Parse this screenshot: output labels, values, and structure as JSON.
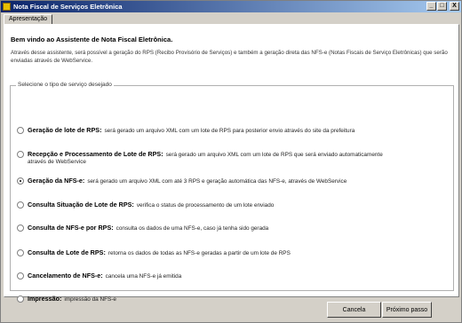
{
  "window": {
    "title": "Nota Fiscal de Serviços Eletrônica",
    "minimize_glyph": "_",
    "maximize_glyph": "□",
    "close_glyph": "X"
  },
  "tabs": [
    {
      "label": "Apresentação"
    }
  ],
  "panel": {
    "welcome": "Bem vindo ao Assistente de Nota Fiscal Eletrônica.",
    "intro": "Através desse assistente, será possível a geração do RPS (Recibo Provisório de Serviços) e também a geração direta das NFS-e (Notas Fiscais de Serviço Eletrônicas) que serão enviadas através de WebService.",
    "group_title": "Selecione o tipo de serviço desejado",
    "options": [
      {
        "label": "Geração de lote de RPS:",
        "desc": "será gerado um arquivo XML com um lote de RPS para posterior envio através do site da prefeitura",
        "checked": false
      },
      {
        "label": "Recepção e Processamento de Lote de RPS:",
        "desc": "será gerado um arquivo XML com um lote de RPS que será enviado automaticamente através de WebService",
        "checked": false
      },
      {
        "label": "Geração da NFS-e:",
        "desc": "será gerado um arquivo XML com até 3 RPS e geração automática das NFS-e, através de WebService",
        "checked": true
      },
      {
        "label": "Consulta Situação de Lote de RPS:",
        "desc": "verifica o status de processamento de um lote enviado",
        "checked": false
      },
      {
        "label": "Consulta de NFS-e por RPS:",
        "desc": "consulta os dados de uma NFS-e, caso já tenha sido gerada",
        "checked": false
      },
      {
        "label": "Consulta de Lote de RPS:",
        "desc": "retorna os dados de todas as NFS-e geradas a partir de um lote de RPS",
        "checked": false
      },
      {
        "label": "Cancelamento de NFS-e:",
        "desc": "cancela uma NFS-e já emitida",
        "checked": false
      },
      {
        "label": "Impressão:",
        "desc": "impressão da NFS-e",
        "checked": false
      }
    ]
  },
  "buttons": {
    "cancel": "Cancela",
    "next": "Próximo passo"
  }
}
